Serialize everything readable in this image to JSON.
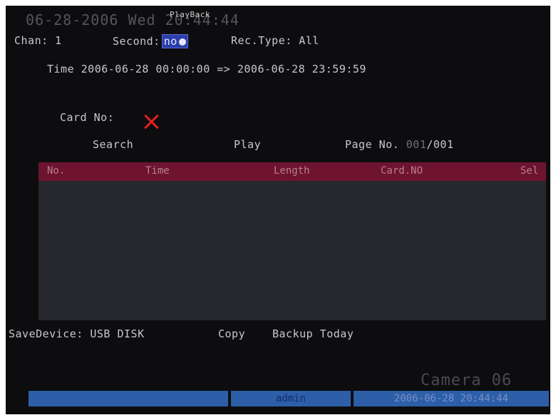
{
  "overlay": {
    "date_time": "06-28-2006 Wed 20:44:44",
    "title": "PlayBack"
  },
  "filters": {
    "chan_label": "Chan: 1",
    "second_label": "Second:",
    "second_value": "no",
    "rec_type": "Rec.Type: All"
  },
  "time_range": "Time 2006-06-28  00:00:00 => 2006-06-28  23:59:59",
  "card_no_label": "Card No:",
  "actions": {
    "search": "Search",
    "play": "Play"
  },
  "pagination": {
    "label": "Page No.",
    "current": "001",
    "total": "/001"
  },
  "table": {
    "columns": [
      "No.",
      "Time",
      "Length",
      "Card.NO",
      "Sel"
    ],
    "rows": []
  },
  "backup": {
    "save_device": "SaveDevice: USB DISK",
    "copy": "Copy",
    "backup_today": "Backup Today"
  },
  "camera_label": "Camera 06",
  "status_bar": {
    "user": "admin",
    "datetime": "2006-06-28 20:44:44"
  },
  "colors": {
    "header_bg": "#6e1330",
    "status_bg": "#2c5fa8",
    "selector_bg": "#2a3fa8",
    "card_icon": "#e02020"
  }
}
